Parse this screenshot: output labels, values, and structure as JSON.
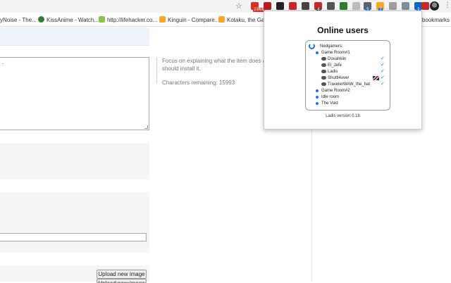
{
  "browser": {
    "star_glyph": "☆",
    "menu_glyph": "⋮",
    "extensions": [
      {
        "name": "gmail-icon",
        "color": "#d93025",
        "badge": "1968"
      },
      {
        "name": "shield-icon",
        "color": "#b71c1c",
        "badge": ""
      },
      {
        "name": "stack-icon",
        "color": "#222222",
        "badge": ""
      },
      {
        "name": "lastpass-icon",
        "color": "#cc2229",
        "badge": ""
      },
      {
        "name": "moon-icon",
        "color": "#444444",
        "badge": ""
      },
      {
        "name": "camera-icon",
        "color": "#c62828",
        "badge": "4"
      },
      {
        "name": "puzzle-icon",
        "color": "#555555",
        "badge": ""
      },
      {
        "name": "refresh-icon",
        "color": "#2e7d32",
        "badge": ""
      },
      {
        "name": "circle-icon",
        "color": "#bdbdbd",
        "badge": ""
      },
      {
        "name": "mail-icon",
        "color": "#5f6368",
        "badge": "5"
      },
      {
        "name": "pie-icon",
        "color": "#f9a825",
        "badge": "3"
      },
      {
        "name": "gray-icon",
        "color": "#9e9e9e",
        "badge": ""
      },
      {
        "name": "feather-icon",
        "color": "#78909c",
        "badge": ""
      },
      {
        "name": "phone-icon",
        "color": "#1565c0",
        "badge": "1"
      },
      {
        "name": "lads-icon",
        "color": "#c62828",
        "badge": ""
      }
    ]
  },
  "bookmarks": [
    {
      "label": "yNoise - The...",
      "icon": "bm-noise-icon",
      "color": "#9e9e9e"
    },
    {
      "label": "KissAnime - Watch...",
      "icon": "kissanime-icon",
      "color": "#2e7d32"
    },
    {
      "label": "http://lifehacker.co...",
      "icon": "lifehacker-icon",
      "color": "#8bc34a"
    },
    {
      "label": "Kinguin - Compare...",
      "icon": "crown-icon",
      "color": "#f9a825"
    },
    {
      "label": "Kotaku, the Game",
      "icon": "kotaku-icon",
      "color": "#f9a825"
    },
    {
      "label": "r bookmarks",
      "icon": "",
      "color": ""
    }
  ],
  "page": {
    "textarea_value": ".",
    "help_text": "Focus on explaining what the item does and should install it.",
    "chars_remaining": "Characters remaining: 15993",
    "upload_label": "Upload new image",
    "upload_label_2": "Upload new image"
  },
  "popup": {
    "title": "Online users",
    "server": "Nedgamers:",
    "rooms": [
      {
        "label": "Game Room#1",
        "users": [
          {
            "name": "Dovahkiin",
            "flag": false
          },
          {
            "name": "El_Jefe",
            "flag": false
          },
          {
            "name": "Ladis",
            "flag": false
          },
          {
            "name": "Shuttl4over",
            "flag": true
          },
          {
            "name": "TravelerWAW_the_hat",
            "flag": false
          }
        ]
      },
      {
        "label": "Game Room#2",
        "users": []
      },
      {
        "label": "Idle room",
        "users": []
      },
      {
        "label": "The Void",
        "users": []
      }
    ],
    "check_glyph": "✓",
    "version": "Ladis version 0.1b"
  }
}
